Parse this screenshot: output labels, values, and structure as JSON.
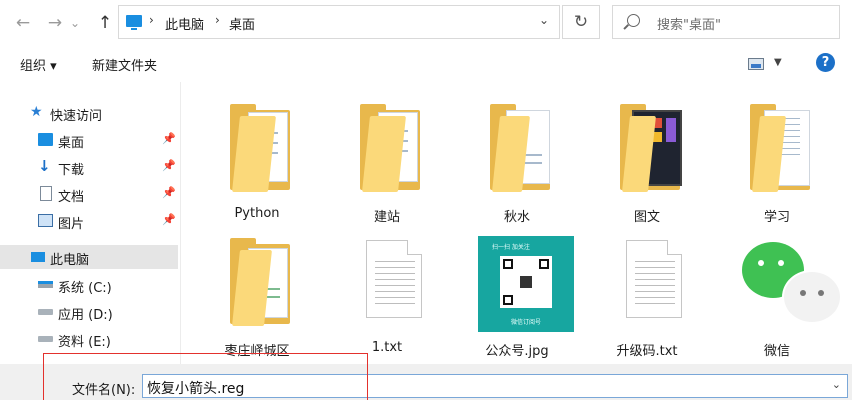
{
  "nav": {
    "back": "←",
    "forward": "→",
    "recent": "⌄",
    "up": "↑"
  },
  "address": {
    "sep": "›",
    "crumbs": [
      "此电脑",
      "桌面"
    ],
    "refresh": "↻",
    "dropdown": "⌄"
  },
  "search": {
    "placeholder": "搜索\"桌面\""
  },
  "toolbar": {
    "organize": "组织 ▾",
    "new_folder": "新建文件夹",
    "view_dd": "▼",
    "help": "?"
  },
  "sidebar": {
    "quick_access": "快速访问",
    "items": [
      {
        "label": "桌面",
        "pinned": true
      },
      {
        "label": "下载",
        "pinned": true
      },
      {
        "label": "文档",
        "pinned": true
      },
      {
        "label": "图片",
        "pinned": true
      }
    ],
    "pin_glyph": "📌",
    "this_pc": "此电脑",
    "drives": [
      "系统 (C:)",
      "应用 (D:)",
      "资料 (E:)"
    ]
  },
  "files": [
    {
      "name": "Python",
      "type": "folder-doc"
    },
    {
      "name": "建站",
      "type": "folder-doc"
    },
    {
      "name": "秋水",
      "type": "folder-word"
    },
    {
      "name": "图文",
      "type": "folder-tablet"
    },
    {
      "name": "学习",
      "type": "folder-list"
    },
    {
      "name": "枣庄峄城区",
      "type": "folder-excel"
    },
    {
      "name": "1.txt",
      "type": "txt"
    },
    {
      "name": "公众号.jpg",
      "type": "qr-image"
    },
    {
      "name": "升级码.txt",
      "type": "txt"
    },
    {
      "name": "微信",
      "type": "wechat"
    }
  ],
  "qr_image": {
    "header": "扫一扫 加关注",
    "footer": "微信订阅号"
  },
  "filename": {
    "label": "文件名(N):",
    "value": "恢复小箭头.reg",
    "dropdown": "⌄"
  },
  "colors": {
    "highlight": "#e3312d",
    "folder": "#fbd97a",
    "accent": "#1a8ee0",
    "wechat": "#3fc153"
  }
}
